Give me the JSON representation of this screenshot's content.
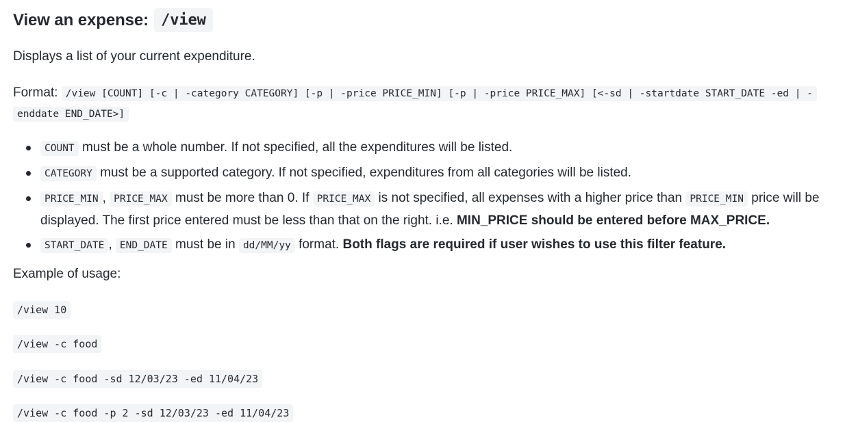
{
  "heading": {
    "text": "View an expense:",
    "command": "/view"
  },
  "description": "Displays a list of your current expenditure.",
  "format": {
    "label": "Format:",
    "syntax": "/view [COUNT] [-c | -category CATEGORY] [-p | -price PRICE_MIN] [-p | -price PRICE_MAX] [<-sd | -startdate START_DATE -ed | -enddate END_DATE>]"
  },
  "rules": [
    {
      "code1": "COUNT",
      "text": "must be a whole number. If not specified, all the expenditures will be listed."
    },
    {
      "code1": "CATEGORY",
      "text": "must be a supported category. If not specified, expenditures from all categories will be listed."
    },
    {
      "code1": "PRICE_MIN",
      "sep": ",",
      "code2": "PRICE_MAX",
      "text_a": "must be more than 0. If",
      "code3": "PRICE_MAX",
      "text_b": "is not specified, all expenses with a higher price than",
      "code4": "PRICE_MIN",
      "text_c": "price will be displayed. The first price entered must be less than that on the right. i.e.",
      "bold": "MIN_PRICE should be entered before MAX_PRICE."
    },
    {
      "code1": "START_DATE",
      "sep": ",",
      "code2": "END_DATE",
      "text_a": "must be in",
      "code3": "dd/MM/yy",
      "text_b": "format.",
      "bold": "Both flags are required if user wishes to use this filter feature."
    }
  ],
  "examples": {
    "label": "Example of usage:",
    "items": [
      "/view 10",
      "/view -c food",
      "/view -c food -sd 12/03/23 -ed 11/04/23",
      "/view -c food -p 2 -sd 12/03/23 -ed 11/04/23"
    ]
  }
}
